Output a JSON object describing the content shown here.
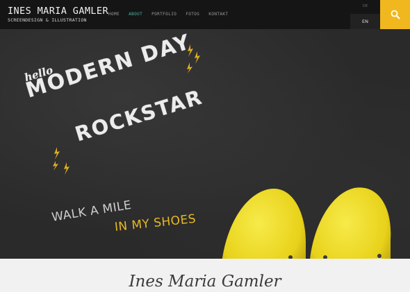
{
  "header": {
    "brand_name": "INES MARIA GAMLER",
    "brand_tagline": "SCREENDESIGN & ILLUSTRATION",
    "nav": [
      {
        "label": "HOME",
        "active": false
      },
      {
        "label": "ABOUT",
        "active": true
      },
      {
        "label": "PORTFOLIO",
        "active": false
      },
      {
        "label": "FOTOS",
        "active": false
      },
      {
        "label": "KONTAKT",
        "active": false
      }
    ],
    "languages": {
      "inactive": "DE",
      "active": "EN"
    },
    "search_icon": "search-icon",
    "accent_color": "#f0b81e",
    "nav_active_color": "#4bb6a6"
  },
  "hero": {
    "hello": "hello",
    "line1": "MODERN DAY",
    "line2": "ROCKSTAR",
    "walk": "WALK A MILE",
    "shoes": "IN MY SHOES",
    "shoe_color": "#f3df2a"
  },
  "footer": {
    "title": "Ines Maria Gamler"
  }
}
